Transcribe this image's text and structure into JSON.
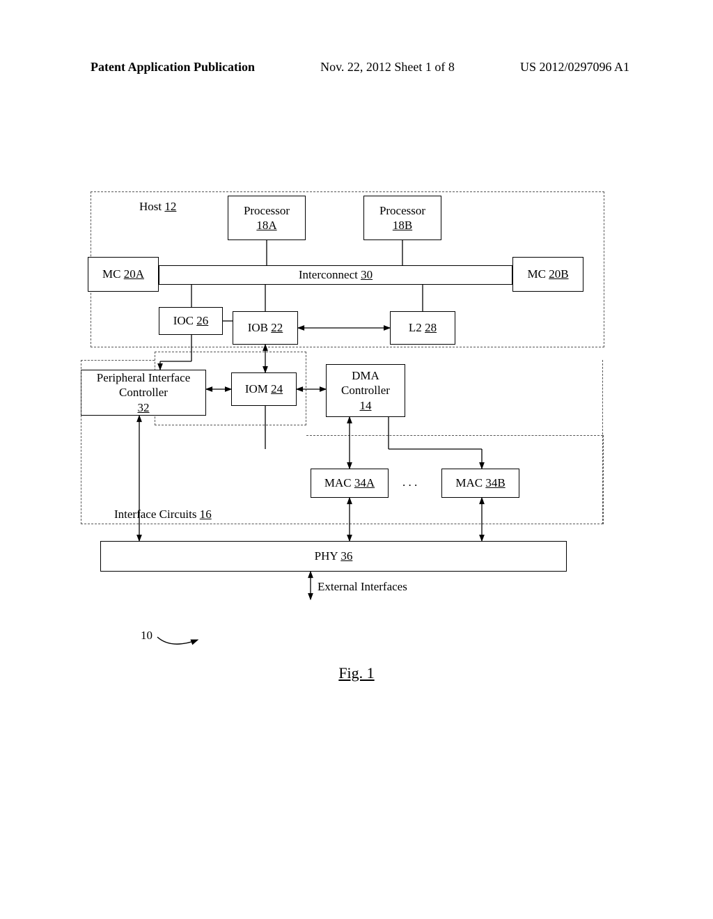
{
  "header": {
    "left": "Patent Application Publication",
    "center": "Nov. 22, 2012  Sheet 1 of 8",
    "right": "US 2012/0297096 A1"
  },
  "blocks": {
    "host_label": "Host",
    "host_ref": "12",
    "proc_a_label": "Processor",
    "proc_a_ref": "18A",
    "proc_b_label": "Processor",
    "proc_b_ref": "18B",
    "mc_a_label": "MC",
    "mc_a_ref": "20A",
    "interconnect_label": "Interconnect",
    "interconnect_ref": "30",
    "mc_b_label": "MC",
    "mc_b_ref": "20B",
    "ioc_label": "IOC",
    "ioc_ref": "26",
    "iob_label": "IOB",
    "iob_ref": "22",
    "l2_label": "L2",
    "l2_ref": "28",
    "periph_label": "Peripheral Interface Controller",
    "periph_ref": "32",
    "iom_label": "IOM",
    "iom_ref": "24",
    "dma_label": "DMA Controller",
    "dma_ref": "14",
    "mac_a_label": "MAC",
    "mac_a_ref": "34A",
    "mac_b_label": "MAC",
    "mac_b_ref": "34B",
    "dots": ". . .",
    "ifc_label": "Interface Circuits",
    "ifc_ref": "16",
    "phy_label": "PHY",
    "phy_ref": "36",
    "ext_if_label": "External Interfaces",
    "ref10": "10"
  },
  "caption": "Fig. 1"
}
